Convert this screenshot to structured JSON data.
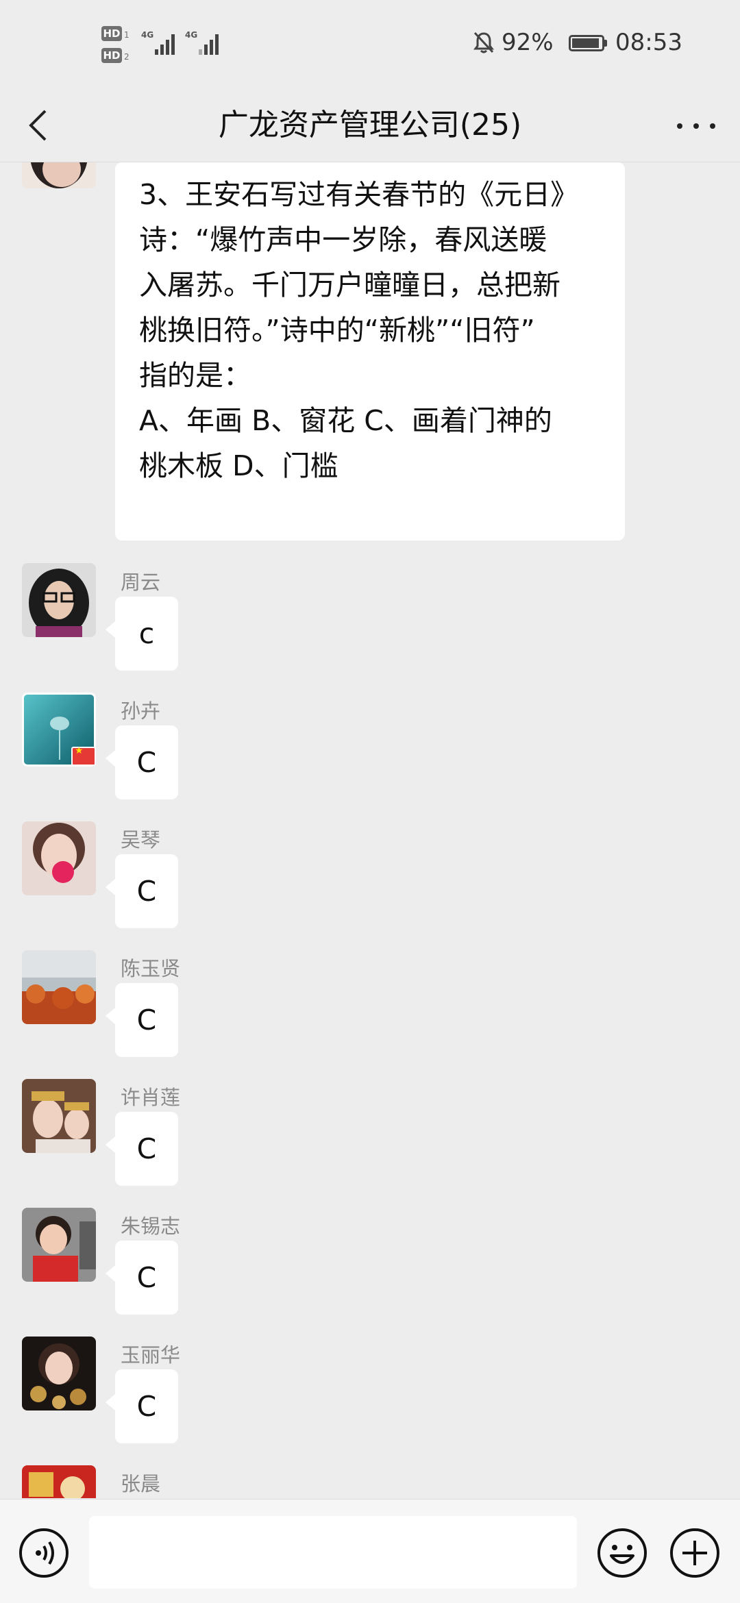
{
  "status_bar": {
    "hd1": "HD",
    "hd1_sub": "1",
    "hd2": "HD",
    "hd2_sub": "2",
    "net1": "4G",
    "net2": "4G",
    "battery_percent": "92%",
    "battery_level": 0.92,
    "time": "08:53",
    "icons": [
      "bell-muted-icon",
      "battery-icon",
      "signal-icon"
    ]
  },
  "header": {
    "title": "广龙资产管理公司(25)",
    "back_icon": "chevron-left-icon",
    "more_icon": "more-dots-icon"
  },
  "question_message": {
    "text_lines": [
      "3、王安石写过有关春节的《元日》",
      "诗：“爆竹声中一岁除，春风送暖",
      "入屠苏。千门万户曈曈日，总把新",
      "桃换旧符。”诗中的“新桃”“旧符”",
      "指的是：",
      "A、年画 B、窗花 C、画着门神的",
      "桃木板 D、门槛"
    ]
  },
  "messages": [
    {
      "sender": "周云",
      "text": "c"
    },
    {
      "sender": "孙卉",
      "text": "C"
    },
    {
      "sender": "吴琴",
      "text": "C"
    },
    {
      "sender": "陈玉贤",
      "text": "C"
    },
    {
      "sender": "许肖莲",
      "text": "C"
    },
    {
      "sender": "朱锡志",
      "text": "C"
    },
    {
      "sender": "玉丽华",
      "text": "C"
    },
    {
      "sender": "张晨",
      "text": ""
    }
  ],
  "input_bar": {
    "voice_icon": "voice-icon",
    "text_value": "",
    "emoji_icon": "emoji-icon",
    "plus_icon": "plus-circle-icon"
  }
}
